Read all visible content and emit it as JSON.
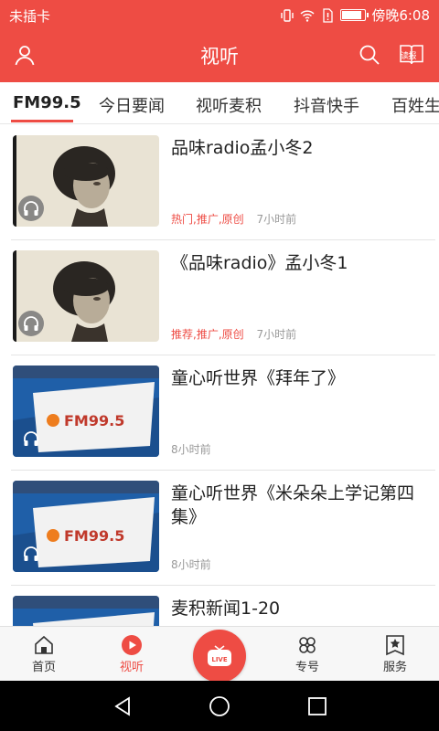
{
  "status_bar": {
    "carrier": "未插卡",
    "time": "傍晚6:08"
  },
  "app_bar": {
    "title": "视听",
    "left_icon": "user-icon",
    "right_icons": [
      "search-icon",
      "reading-book-icon"
    ],
    "book_label": "读报"
  },
  "tabs": [
    {
      "label": "FM99.5",
      "active": true
    },
    {
      "label": "今日要闻",
      "active": false
    },
    {
      "label": "视听麦积",
      "active": false
    },
    {
      "label": "抖音快手",
      "active": false
    },
    {
      "label": "百姓生",
      "active": false
    }
  ],
  "items": [
    {
      "title": "品味radio孟小冬2",
      "tags": "热门,推广,原创",
      "time": "7小时前",
      "thumb": "portrait-photo"
    },
    {
      "title": "《品味radio》孟小冬1",
      "tags": "推荐,推广,原创",
      "time": "7小时前",
      "thumb": "portrait-photo"
    },
    {
      "title": "童心听世界《拜年了》",
      "tags": "",
      "time": "8小时前",
      "thumb": "fm995-studio-photo"
    },
    {
      "title": "童心听世界《米朵朵上学记第四集》",
      "tags": "",
      "time": "8小时前",
      "thumb": "fm995-studio-photo"
    },
    {
      "title": "麦积新闻1-20",
      "tags": "",
      "time": "",
      "thumb": "fm995-studio-photo"
    }
  ],
  "thumb_sign_text": "FM99.5",
  "bottom_nav": [
    {
      "label": "首页",
      "icon": "home-icon",
      "active": false
    },
    {
      "label": "视听",
      "icon": "play-circle-icon",
      "active": true
    },
    {
      "label": "LIVE",
      "icon": "live-tv-icon",
      "active": false
    },
    {
      "label": "专号",
      "icon": "clover-icon",
      "active": false
    },
    {
      "label": "服务",
      "icon": "star-bookmark-icon",
      "active": false
    }
  ],
  "colors": {
    "accent": "#ee4c44",
    "tag_red": "#ee4c44",
    "meta_gray": "#999999"
  }
}
